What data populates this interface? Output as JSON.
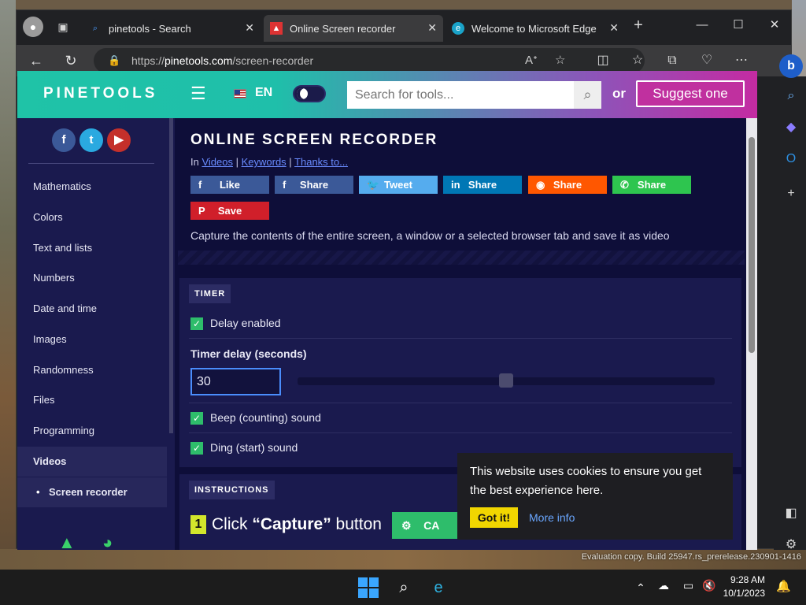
{
  "browser": {
    "tabs": [
      {
        "title": "pinetools - Search",
        "favicon": "search-icon"
      },
      {
        "title": "Online Screen recorder",
        "favicon": "pinetools-favicon"
      },
      {
        "title": "Welcome to Microsoft Edge",
        "favicon": "edge-icon"
      }
    ],
    "url_prefix": "https://",
    "url_host": "pinetools.com",
    "url_path": "/screen-recorder"
  },
  "site": {
    "logo": "PINETOOLS",
    "lang": "EN",
    "search_placeholder": "Search for tools...",
    "or_text": "or",
    "suggest_label": "Suggest one"
  },
  "sidebar": {
    "items": [
      {
        "label": "Mathematics"
      },
      {
        "label": "Colors"
      },
      {
        "label": "Text and lists"
      },
      {
        "label": "Numbers"
      },
      {
        "label": "Date and time"
      },
      {
        "label": "Images"
      },
      {
        "label": "Randomness"
      },
      {
        "label": "Files"
      },
      {
        "label": "Programming"
      },
      {
        "label": "Videos"
      },
      {
        "label": "Screen recorder"
      }
    ]
  },
  "main": {
    "title": "ONLINE SCREEN RECORDER",
    "crumb_prefix": "In",
    "crumb_links": [
      "Videos",
      "Keywords",
      "Thanks to..."
    ],
    "share": {
      "like": "Like",
      "facebook": "Share",
      "twitter": "Tweet",
      "linkedin": "Share",
      "reddit": "Share",
      "whatsapp": "Share",
      "pinterest": "Save"
    },
    "description": "Capture the contents of the entire screen, a window or a selected browser tab and save it as video"
  },
  "timer": {
    "section_label": "TIMER",
    "delay_enabled_label": "Delay enabled",
    "delay_label": "Timer delay (seconds)",
    "delay_value": "30",
    "slider_fraction": 0.5,
    "beep_label": "Beep (counting) sound",
    "ding_label": "Ding (start) sound"
  },
  "instructions": {
    "section_label": "INSTRUCTIONS",
    "step_number": "1",
    "step_text_prefix": "Click ",
    "step_text_bold": "“Capture”",
    "step_text_suffix": " button",
    "capture_button": "CA"
  },
  "cookie": {
    "message": "This website uses cookies to ensure you get the best experience here.",
    "ok": "Got it!",
    "more": "More info"
  },
  "desktop": {
    "evaluation": "Evaluation copy. Build 25947.rs_prerelease.230901-1416"
  },
  "taskbar": {
    "time": "9:28 AM",
    "date": "10/1/2023"
  },
  "colors": {
    "page_bg": "#0e0e39",
    "header_start": "#1fc3a7",
    "header_end": "#c42ba2",
    "accent_green": "#2ebd6b",
    "suggest_bg": "#c0309f"
  }
}
